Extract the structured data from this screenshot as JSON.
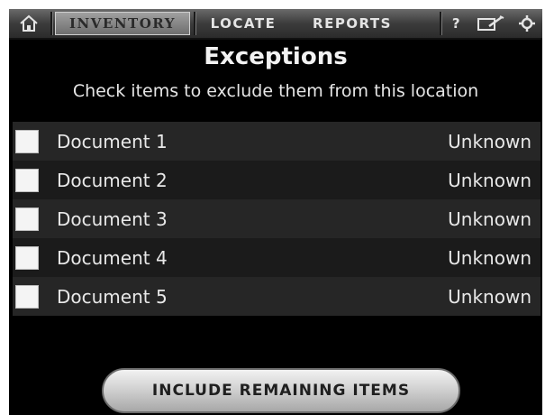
{
  "nav": {
    "home_icon": "home-icon",
    "inventory_label": "INVENTORY",
    "locate_label": "LOCATE",
    "reports_label": "REPORTS",
    "help_label": "?",
    "edit_icon": "edit-icon",
    "settings_icon": "settings-icon"
  },
  "header": {
    "title": "Exceptions",
    "subtitle": "Check items to exclude them from this location"
  },
  "items": [
    {
      "name": "Document 1",
      "status": "Unknown",
      "checked": false
    },
    {
      "name": "Document 2",
      "status": "Unknown",
      "checked": false
    },
    {
      "name": "Document 3",
      "status": "Unknown",
      "checked": false
    },
    {
      "name": "Document 4",
      "status": "Unknown",
      "checked": false
    },
    {
      "name": "Document 5",
      "status": "Unknown",
      "checked": false
    }
  ],
  "actions": {
    "include_label": "INCLUDE REMAINING ITEMS"
  }
}
